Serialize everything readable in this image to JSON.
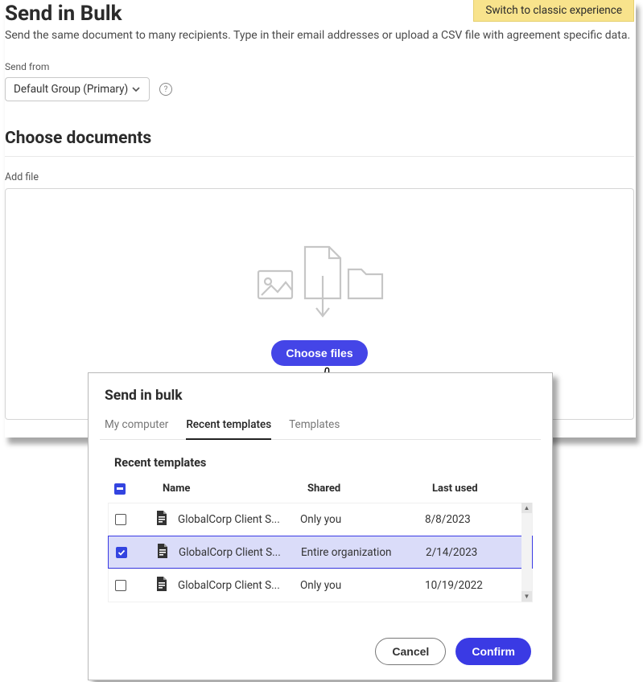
{
  "classic_link": "Switch to classic experience",
  "title": "Send in Bulk",
  "subtitle": "Send the same document to many recipients. Type in their email addresses or upload a CSV file with agreement specific data.",
  "send_from_label": "Send from",
  "send_from_value": "Default Group (Primary)",
  "choose_heading": "Choose documents",
  "add_file_label": "Add file",
  "choose_files_btn": "Choose files",
  "modal": {
    "title": "Send in bulk",
    "tabs": {
      "my": "My computer",
      "recent": "Recent templates",
      "tmpl": "Templates"
    },
    "section": "Recent templates",
    "cols": {
      "name": "Name",
      "shared": "Shared",
      "last": "Last used"
    },
    "rows": [
      {
        "name": "GlobalCorp Client S...",
        "shared": "Only you",
        "last": "8/8/2023",
        "checked": false,
        "selected": false
      },
      {
        "name": "GlobalCorp Client S...",
        "shared": "Entire organization",
        "last": "2/14/2023",
        "checked": true,
        "selected": true
      },
      {
        "name": "GlobalCorp Client S...",
        "shared": "Only you",
        "last": "10/19/2022",
        "checked": false,
        "selected": false
      }
    ],
    "cancel": "Cancel",
    "confirm": "Confirm"
  }
}
